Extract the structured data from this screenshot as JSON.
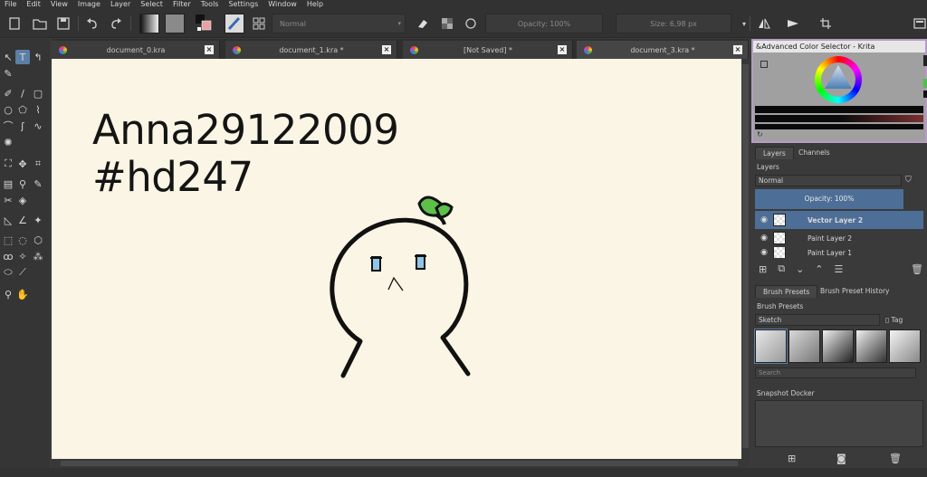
{
  "menu": [
    "File",
    "Edit",
    "View",
    "Image",
    "Layer",
    "Select",
    "Filter",
    "Tools",
    "Settings",
    "Window",
    "Help"
  ],
  "toolbar": {
    "blend_mode": "Normal",
    "opacity": "Opacity: 100%",
    "size": "Size: 6,98 px"
  },
  "tabs": [
    {
      "label": "document_0.kra"
    },
    {
      "label": "document_1.kra *"
    },
    {
      "label": "[Not Saved]  *"
    },
    {
      "label": "document_3.kra *"
    }
  ],
  "canvas": {
    "line1": "Anna29122009",
    "line2": "#hd247"
  },
  "color_selector": {
    "title": "&Advanced Color Selector - Krita"
  },
  "layers_docker": {
    "tabs": [
      "Layers",
      "Channels"
    ],
    "header": "Layers",
    "blend_mode": "Normal",
    "opacity": "Opacity:  100%",
    "layers": [
      {
        "name": "Vector Layer 2",
        "selected": true
      },
      {
        "name": "Paint Layer 2",
        "selected": false
      },
      {
        "name": "Paint Layer 1",
        "selected": false
      }
    ]
  },
  "brush_docker": {
    "tabs": [
      "Brush Presets",
      "Brush Preset History"
    ],
    "header": "Brush Presets",
    "group": "Sketch",
    "tag_label": "Tag",
    "search_placeholder": "Search"
  },
  "snapshot": {
    "title": "Snapshot Docker"
  },
  "colors": {
    "canvas_bg": "#faf5e4",
    "accent": "#5b7fa6",
    "layer_selected": "#4d6f97",
    "sprout_green": "#5cc04a",
    "eye_blue": "#8ec5e8"
  }
}
